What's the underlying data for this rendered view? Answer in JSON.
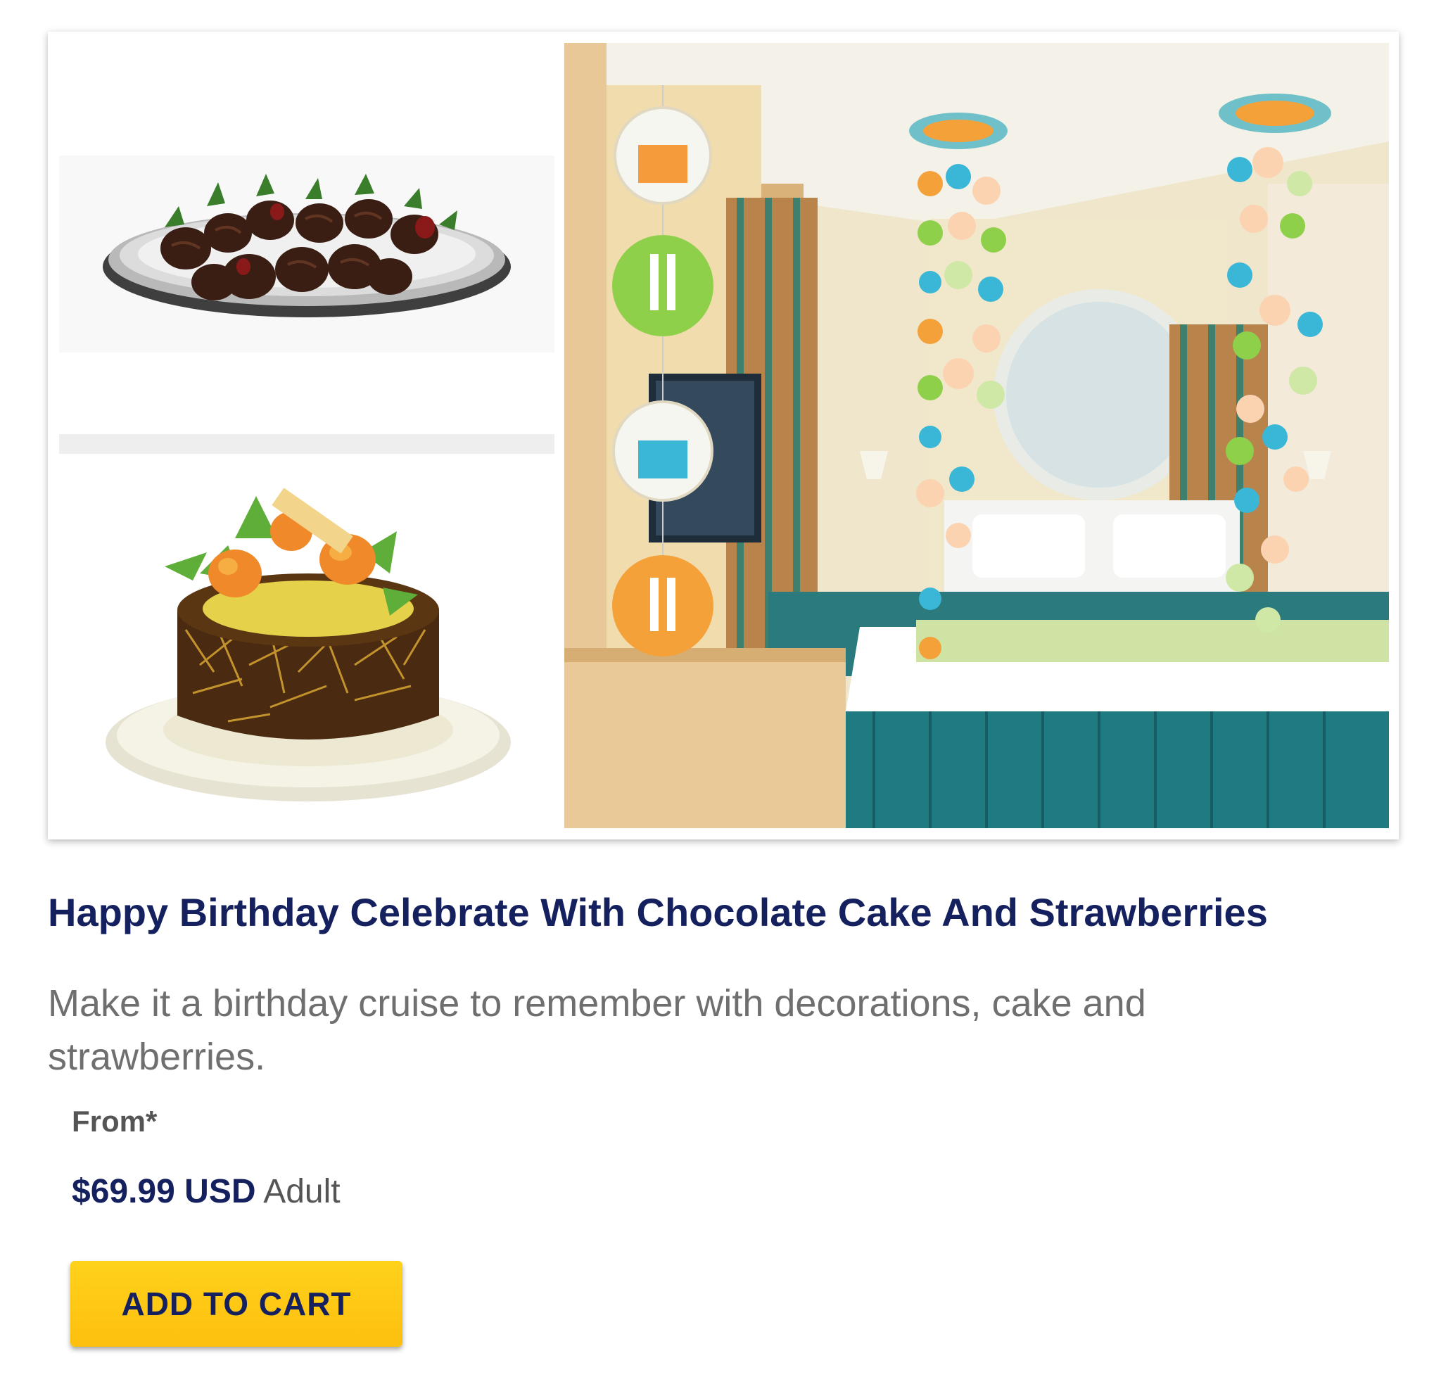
{
  "product": {
    "title": "Happy Birthday Celebrate With Chocolate Cake And Strawberries",
    "description": "Make it a birthday cruise to remember with decorations, cake and strawberries.",
    "price_prefix": "From*",
    "price_amount": "$69.99 USD",
    "price_unit": "Adult",
    "cta_label": "ADD TO CART"
  },
  "images": [
    {
      "name": "chocolate-covered-strawberries"
    },
    {
      "name": "chocolate-birthday-cake"
    },
    {
      "name": "decorated-stateroom"
    }
  ],
  "colors": {
    "title": "#15205e",
    "price": "#15205e",
    "description": "#6f6f6f",
    "button": "#fdc010"
  }
}
